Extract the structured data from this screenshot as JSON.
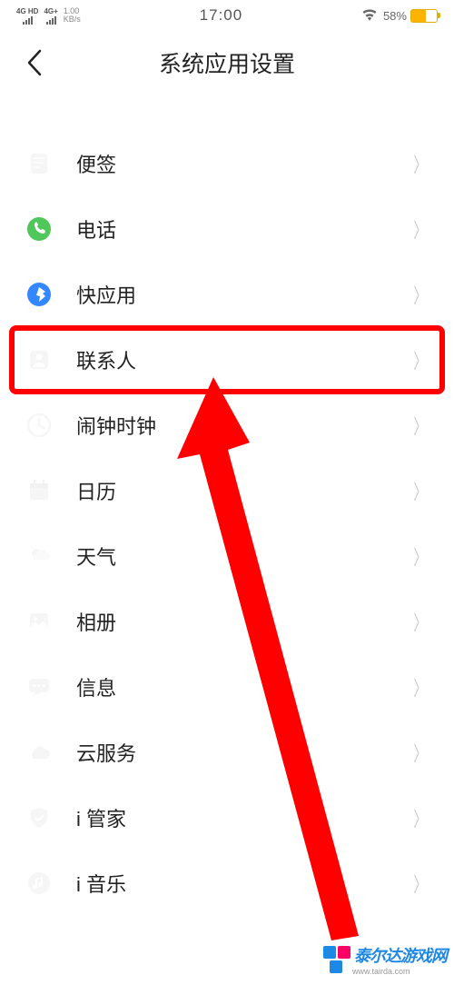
{
  "status": {
    "signal1": "4G HD",
    "signal2": "4G+",
    "kbps_top": "1.00",
    "kbps_bottom": "KB/s",
    "time": "17:00",
    "battery_pct": "58%"
  },
  "header": {
    "title": "系统应用设置"
  },
  "rows": [
    {
      "id": "notes",
      "label": "便签",
      "icon": "note-icon",
      "faded": true
    },
    {
      "id": "phone",
      "label": "电话",
      "icon": "phone-icon",
      "faded": false
    },
    {
      "id": "quickapp",
      "label": "快应用",
      "icon": "quickapp-icon",
      "faded": false
    },
    {
      "id": "contacts",
      "label": "联系人",
      "icon": "contacts-icon",
      "faded": true
    },
    {
      "id": "clock",
      "label": "闹钟时钟",
      "icon": "clock-icon",
      "faded": true
    },
    {
      "id": "calendar",
      "label": "日历",
      "icon": "calendar-icon",
      "faded": true
    },
    {
      "id": "weather",
      "label": "天气",
      "icon": "weather-icon",
      "faded": true
    },
    {
      "id": "gallery",
      "label": "相册",
      "icon": "gallery-icon",
      "faded": true
    },
    {
      "id": "messages",
      "label": "信息",
      "icon": "messages-icon",
      "faded": true
    },
    {
      "id": "cloud",
      "label": "云服务",
      "icon": "cloud-icon",
      "faded": true
    },
    {
      "id": "imanager",
      "label": "i 管家",
      "icon": "shield-icon",
      "faded": true
    },
    {
      "id": "imusic",
      "label": "i 音乐",
      "icon": "music-icon",
      "faded": true
    }
  ],
  "watermark": {
    "text": "泰尔达游戏网",
    "url": "www.tairda.com"
  },
  "annotation": {
    "highlight_row": "contacts",
    "colors": {
      "highlight": "#ff0000"
    }
  }
}
